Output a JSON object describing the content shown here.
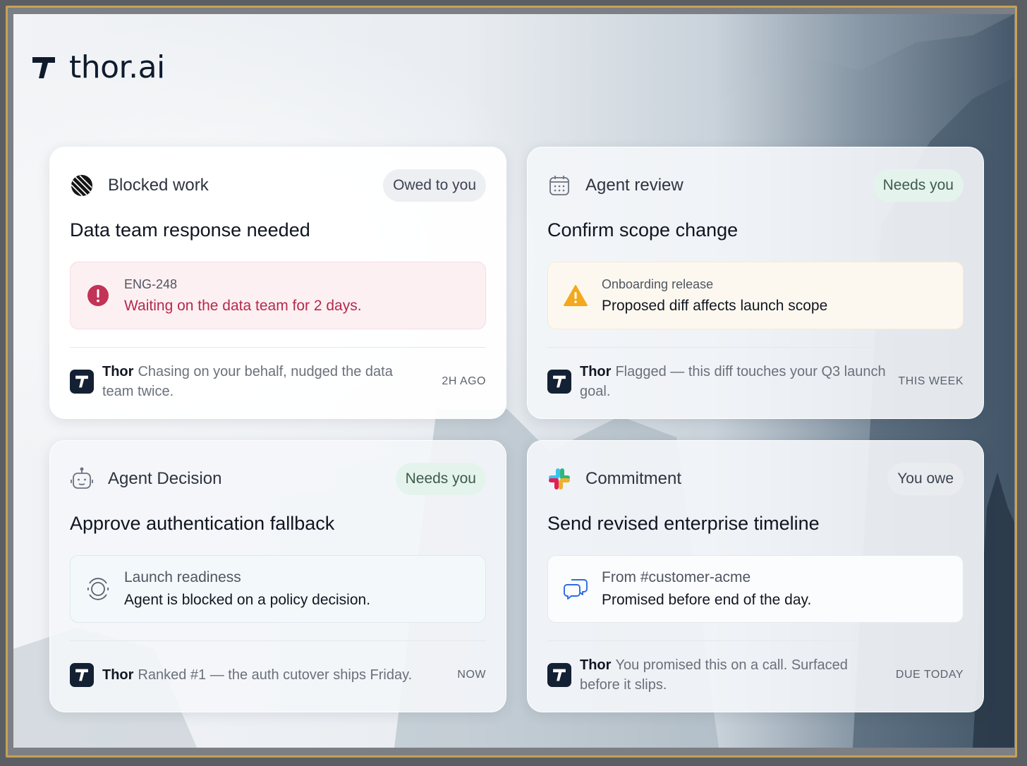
{
  "app": {
    "name": "thor.ai"
  },
  "cards": [
    {
      "category": "Blocked work",
      "category_icon": "linear-icon",
      "badge": "Owed to you",
      "title": "Data team response needed",
      "info_icon": "alert-circle-icon",
      "info_sub": "ENG-248",
      "info_main": "Waiting on the data team for 2 days.",
      "author": "Thor",
      "note": "Chasing on your behalf, nudged the data team twice.",
      "time": "2H AGO"
    },
    {
      "category": "Agent review",
      "category_icon": "calendar-icon",
      "badge": "Needs you",
      "title": "Confirm scope change",
      "info_icon": "warning-triangle-icon",
      "info_sub": "Onboarding release",
      "info_main": "Proposed diff affects launch scope",
      "author": "Thor",
      "note": "Flagged — this diff touches your Q3 launch goal.",
      "time": "THIS WEEK"
    },
    {
      "category": "Agent Decision",
      "category_icon": "robot-icon",
      "badge": "Needs you",
      "title": "Approve authentication fallback",
      "info_icon": "target-icon",
      "info_sub": "Launch readiness",
      "info_main": "Agent is blocked on a policy decision.",
      "author": "Thor",
      "note": "Ranked #1 — the auth cutover ships Friday.",
      "time": "NOW"
    },
    {
      "category": "Commitment",
      "category_icon": "slack-icon",
      "badge": "You owe",
      "title": "Send revised enterprise timeline",
      "info_icon": "chat-bubbles-icon",
      "info_sub": "From #customer-acme",
      "info_main": "Promised before end of the day.",
      "author": "Thor",
      "note": "You promised this on a call. Surfaced before it slips.",
      "time": "DUE TODAY"
    }
  ]
}
